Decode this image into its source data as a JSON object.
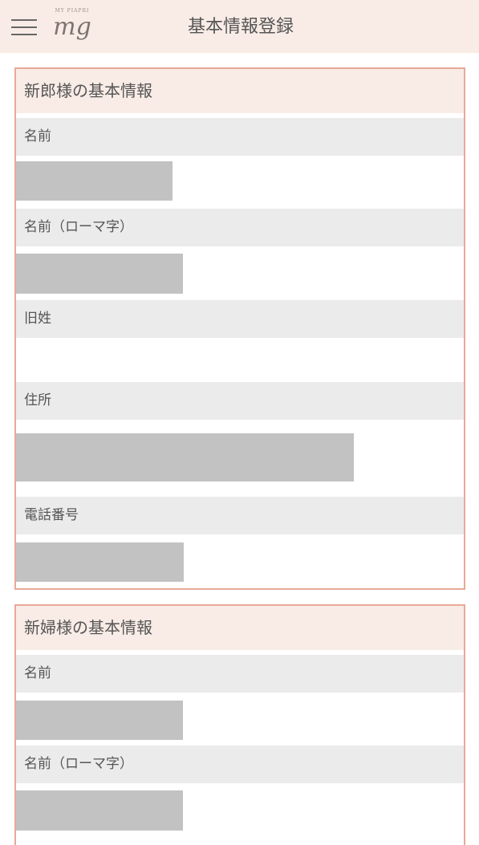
{
  "header": {
    "logo_small_text": "MY PIAPRI",
    "logo_text": "mg",
    "title": "基本情報登録",
    "menu_icon": "hamburger-menu-icon"
  },
  "groom": {
    "section_title": "新郎様の基本情報",
    "fields": [
      {
        "label": "名前"
      },
      {
        "label": "名前（ローマ字）"
      },
      {
        "label": "旧姓"
      },
      {
        "label": "住所"
      },
      {
        "label": "電話番号"
      }
    ]
  },
  "bride": {
    "section_title": "新婦様の基本情報",
    "fields": [
      {
        "label": "名前"
      },
      {
        "label": "名前（ローマ字）"
      }
    ]
  },
  "colors": {
    "header_bg": "#f9ece6",
    "section_border": "#e8a898",
    "label_bg": "#ebebeb",
    "redaction": "#c2c2c2"
  }
}
